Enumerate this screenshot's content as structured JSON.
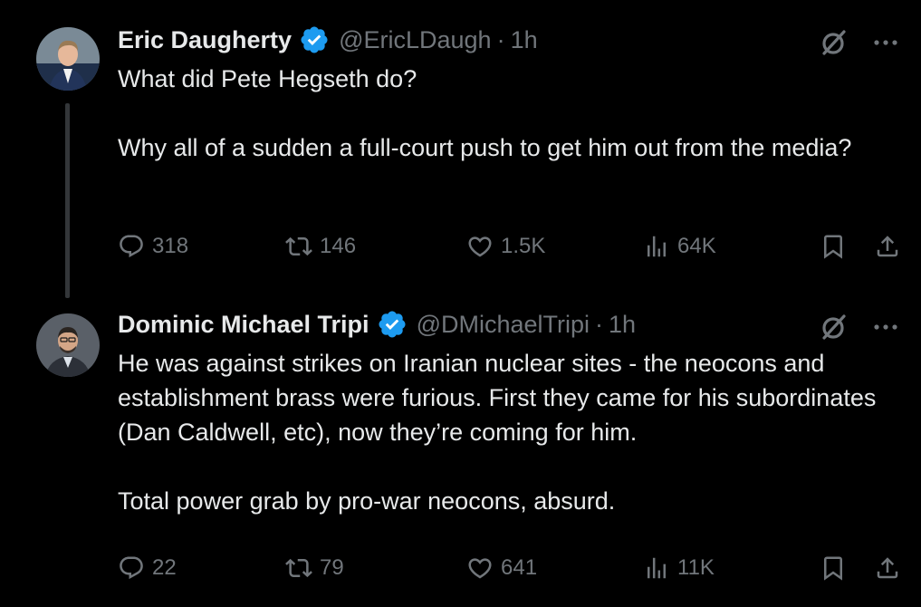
{
  "tweets": [
    {
      "name": "Eric Daugherty",
      "handle": "@EricLDaugh",
      "separator": "·",
      "time": "1h",
      "text": [
        "What did Pete Hegseth do?",
        "Why all of a sudden a full-court push to get him out from the media?"
      ],
      "stats": {
        "replies": "318",
        "reposts": "146",
        "likes": "1.5K",
        "views": "64K"
      }
    },
    {
      "name": "Dominic Michael Tripi",
      "handle": "@DMichaelTripi",
      "separator": "·",
      "time": "1h",
      "text": [
        "He was against strikes on Iranian nuclear sites - the neocons and establishment brass were furious. First they came for his subordinates (Dan Caldwell, etc), now they’re coming for him.",
        "Total power grab by pro-war neocons, absurd."
      ],
      "stats": {
        "replies": "22",
        "reposts": "79",
        "likes": "641",
        "views": "11K"
      }
    }
  ],
  "colors": {
    "background": "#000000",
    "text": "#e7e9ea",
    "muted": "#71767b",
    "verified": "#1d9bf0",
    "thread_line": "#333639"
  },
  "icons": [
    "verified-badge-icon",
    "grok-icon",
    "more-icon",
    "reply-icon",
    "repost-icon",
    "like-icon",
    "views-icon",
    "bookmark-icon",
    "share-icon"
  ]
}
